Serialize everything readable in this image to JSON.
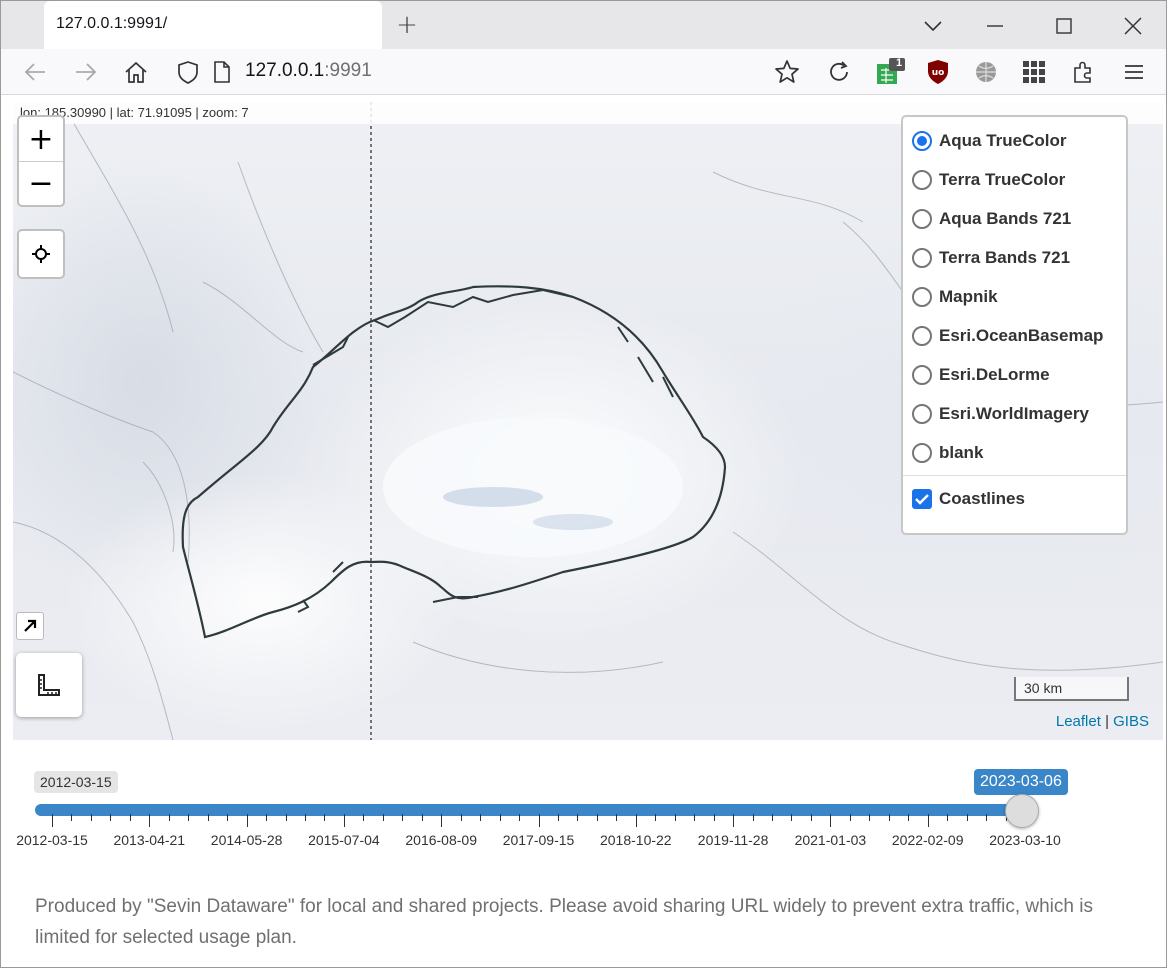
{
  "browser": {
    "tab_title": "127.0.0.1:9991/",
    "url_host": "127.0.0.1",
    "url_port": ":9991",
    "extension_badge": "1"
  },
  "map": {
    "coords_text": "lon: 185.30990 | lat: 71.91095 | zoom: 7",
    "zoom_in": "+",
    "zoom_out": "−",
    "scale_label": "30 km",
    "attribution": {
      "leaflet": "Leaflet",
      "separator": " | ",
      "gibs": "GIBS"
    },
    "layers": [
      {
        "label": "Aqua TrueColor",
        "selected": true
      },
      {
        "label": "Terra TrueColor",
        "selected": false
      },
      {
        "label": "Aqua Bands 721",
        "selected": false
      },
      {
        "label": "Terra Bands 721",
        "selected": false
      },
      {
        "label": "Mapnik",
        "selected": false
      },
      {
        "label": "Esri.OceanBasemap",
        "selected": false
      },
      {
        "label": "Esri.DeLorme",
        "selected": false
      },
      {
        "label": "Esri.WorldImagery",
        "selected": false
      },
      {
        "label": "blank",
        "selected": false
      }
    ],
    "overlay": {
      "label": "Coastlines",
      "checked": true
    }
  },
  "slider": {
    "min_label": "2012-03-15",
    "current_label": "2023-03-06",
    "ticks": [
      "2012-03-15",
      "2013-04-21",
      "2014-05-28",
      "2015-07-04",
      "2016-08-09",
      "2017-09-15",
      "2018-10-22",
      "2019-11-28",
      "2021-01-03",
      "2022-02-09",
      "2023-03-10"
    ]
  },
  "footer": {
    "text": "Produced by \"Sevin Dataware\" for local and shared projects. Please avoid sharing URL widely to prevent extra traffic, which is limited for selected usage plan."
  },
  "colors": {
    "accent": "#1a73e8",
    "slider": "#3a86c8",
    "link": "#0078a8"
  }
}
